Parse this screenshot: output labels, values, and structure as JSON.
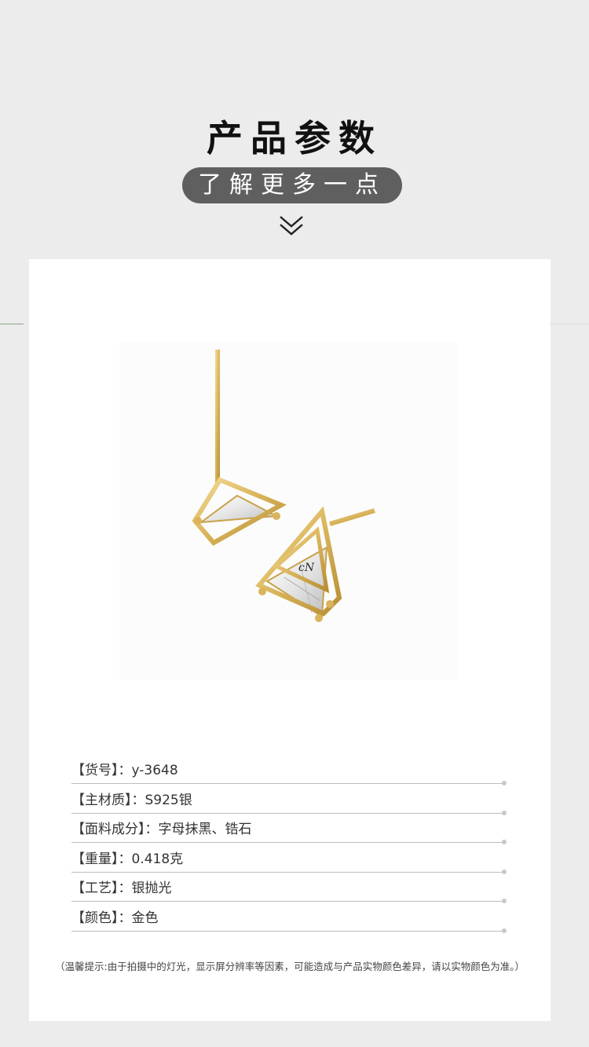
{
  "header": {
    "title": "产品参数",
    "subtitle": "了解更多一点"
  },
  "params": [
    {
      "label": "【货号】",
      "colon": "：",
      "value": "y-3648"
    },
    {
      "label": "【主材质】",
      "colon": "：",
      "value": "S925银"
    },
    {
      "label": "【面料成分】",
      "colon": "：",
      "value": "字母抹黑、锆石"
    },
    {
      "label": "【重量】",
      "colon": "：",
      "value": "0.418克"
    },
    {
      "label": "【工艺】",
      "colon": "：",
      "value": "银抛光"
    },
    {
      "label": "【颜色】",
      "colon": "：",
      "value": "金色"
    }
  ],
  "note": "（温馨提示:由于拍摄中的灯光，显示屏分辨率等因素，可能造成与产品实物颜色差异，请以实物颜色为准。）",
  "colors": {
    "background": "#ececec",
    "pill": "#5f5f5f",
    "gold": "#d9b45a"
  },
  "icons": [
    "double-chevron-down-icon"
  ]
}
